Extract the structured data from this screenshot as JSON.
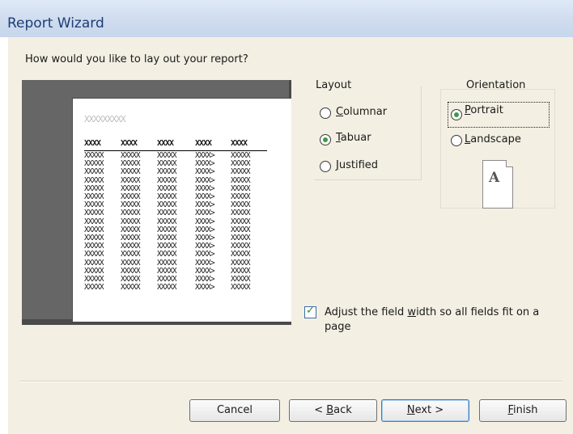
{
  "window": {
    "title": "Report Wizard"
  },
  "question": "How would you like to lay out your report?",
  "preview": {
    "report_title": "XXXXXXXXX",
    "headers": [
      "XXXX",
      "XXXX",
      "XXXX",
      "XXXX",
      "XXXX"
    ],
    "rows": [
      [
        "XXXXX",
        "XXXXX",
        "XXXXX",
        "XXXX>",
        "XXXXX"
      ],
      [
        "XXXXX",
        "XXXXX",
        "XXXXX",
        "XXXX>",
        "XXXXX"
      ],
      [
        "XXXXX",
        "XXXXX",
        "XXXXX",
        "XXXX>",
        "XXXXX"
      ],
      [
        "XXXXX",
        "XXXXX",
        "XXXXX",
        "XXXX>",
        "XXXXX"
      ],
      [
        "XXXXX",
        "XXXXX",
        "XXXXX",
        "XXXX>",
        "XXXXX"
      ],
      [
        "XXXXX",
        "XXXXX",
        "XXXXX",
        "XXXX>",
        "XXXXX"
      ],
      [
        "XXXXX",
        "XXXXX",
        "XXXXX",
        "XXXX>",
        "XXXXX"
      ],
      [
        "XXXXX",
        "XXXXX",
        "XXXXX",
        "XXXX>",
        "XXXXX"
      ],
      [
        "XXXXX",
        "XXXXX",
        "XXXXX",
        "XXXX>",
        "XXXXX"
      ],
      [
        "XXXXX",
        "XXXXX",
        "XXXXX",
        "XXXX>",
        "XXXXX"
      ],
      [
        "XXXXX",
        "XXXXX",
        "XXXXX",
        "XXXX>",
        "XXXXX"
      ],
      [
        "XXXXX",
        "XXXXX",
        "XXXXX",
        "XXXX>",
        "XXXXX"
      ],
      [
        "XXXXX",
        "XXXXX",
        "XXXXX",
        "XXXX>",
        "XXXXX"
      ],
      [
        "XXXXX",
        "XXXXX",
        "XXXXX",
        "XXXX>",
        "XXXXX"
      ],
      [
        "XXXXX",
        "XXXXX",
        "XXXXX",
        "XXXX>",
        "XXXXX"
      ],
      [
        "XXXXX",
        "XXXXX",
        "XXXXX",
        "XXXX>",
        "XXXXX"
      ],
      [
        "XXXXX",
        "XXXXX",
        "XXXXX",
        "XXXX>",
        "XXXXX"
      ]
    ]
  },
  "layout": {
    "label": "Layout",
    "options": [
      {
        "accel": "C",
        "rest": "olumnar",
        "selected": false
      },
      {
        "accel": "T",
        "rest": "abuar",
        "selected": true
      },
      {
        "accel": "J",
        "rest": "ustified",
        "selected": false
      }
    ]
  },
  "orientation": {
    "label": "Orientation",
    "options": [
      {
        "accel": "P",
        "rest": "ortrait",
        "selected": true
      },
      {
        "accel": "L",
        "rest": "andscape",
        "selected": false
      }
    ],
    "page_icon_letter": "A"
  },
  "adjust_width": {
    "checked": true,
    "label_before": "Adjust the field ",
    "label_accel": "w",
    "label_after": "idth so all fields fit on a page"
  },
  "buttons": {
    "cancel": "Cancel",
    "back_prefix": "< ",
    "back_accel": "B",
    "back_rest": "ack",
    "next_accel": "N",
    "next_rest": "ext >",
    "finish_accel": "F",
    "finish_rest": "inish"
  },
  "colors": {
    "title_text": "#1c3d74",
    "dialog_bg": "#f3efe3",
    "radio_selected": "#3d9a46",
    "check_mark": "#2f8a34"
  }
}
